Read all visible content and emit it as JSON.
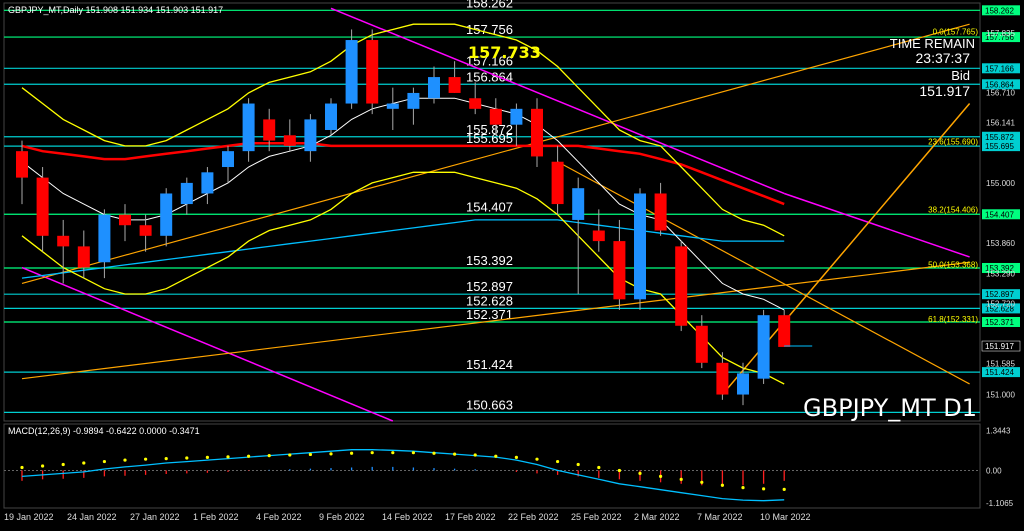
{
  "header": {
    "symbol_info": "GBPJPY_MT,Daily  151.908 151.934 151.903 151.917",
    "watermark": "GBPJPY_MT D1",
    "time_remain_label": "TIME REMAIN",
    "time_remain_value": "23:37:37",
    "bid_label": "Bid",
    "bid_value": "151.917",
    "highlight_price": "157.733"
  },
  "colors": {
    "background": "#000000",
    "bull": "#1e90ff",
    "bear": "#ff0000",
    "level_line": "#00ff7f",
    "level_line_cyan": "#00ced1",
    "magenta_channel": "#ff00ff",
    "yellow_band": "#ffff00",
    "orange_trend": "#ffa500",
    "red_ma": "#ff0000",
    "white_ma": "#ffffff",
    "cyan_ma": "#00bfff",
    "macd_line": "#00bfff",
    "macd_signal": "#ffff00"
  },
  "chart_data": {
    "type": "candlestick",
    "title": "GBPJPY_MT,Daily",
    "ylim": [
      150.5,
      158.4
    ],
    "candles": [
      {
        "d": "18 Jan 2022",
        "o": 155.6,
        "h": 155.8,
        "l": 154.6,
        "c": 155.1
      },
      {
        "d": "19 Jan 2022",
        "o": 155.1,
        "h": 155.3,
        "l": 153.7,
        "c": 154.0
      },
      {
        "d": "20 Jan 2022",
        "o": 154.0,
        "h": 154.3,
        "l": 153.1,
        "c": 153.8
      },
      {
        "d": "21 Jan 2022",
        "o": 153.8,
        "h": 154.1,
        "l": 153.2,
        "c": 153.4
      },
      {
        "d": "24 Jan 2022",
        "o": 153.5,
        "h": 154.5,
        "l": 153.2,
        "c": 154.4
      },
      {
        "d": "25 Jan 2022",
        "o": 154.4,
        "h": 154.6,
        "l": 153.9,
        "c": 154.2
      },
      {
        "d": "26 Jan 2022",
        "o": 154.2,
        "h": 154.4,
        "l": 153.7,
        "c": 154.0
      },
      {
        "d": "27 Jan 2022",
        "o": 154.0,
        "h": 154.9,
        "l": 153.8,
        "c": 154.8
      },
      {
        "d": "28 Jan 2022",
        "o": 154.6,
        "h": 155.1,
        "l": 154.4,
        "c": 155.0
      },
      {
        "d": "31 Jan 2022",
        "o": 154.8,
        "h": 155.3,
        "l": 154.6,
        "c": 155.2
      },
      {
        "d": "1 Feb 2022",
        "o": 155.3,
        "h": 155.7,
        "l": 155.0,
        "c": 155.6
      },
      {
        "d": "2 Feb 2022",
        "o": 155.6,
        "h": 156.6,
        "l": 155.4,
        "c": 156.5
      },
      {
        "d": "3 Feb 2022",
        "o": 156.2,
        "h": 156.4,
        "l": 155.6,
        "c": 155.8
      },
      {
        "d": "4 Feb 2022",
        "o": 155.9,
        "h": 156.2,
        "l": 155.6,
        "c": 155.7
      },
      {
        "d": "7 Feb 2022",
        "o": 155.6,
        "h": 156.3,
        "l": 155.4,
        "c": 156.2
      },
      {
        "d": "8 Feb 2022",
        "o": 156.0,
        "h": 156.6,
        "l": 155.9,
        "c": 156.5
      },
      {
        "d": "9 Feb 2022",
        "o": 156.5,
        "h": 157.9,
        "l": 156.4,
        "c": 157.7
      },
      {
        "d": "10 Feb 2022",
        "o": 157.7,
        "h": 157.9,
        "l": 156.3,
        "c": 156.5
      },
      {
        "d": "11 Feb 2022",
        "o": 156.4,
        "h": 156.8,
        "l": 156.0,
        "c": 156.5
      },
      {
        "d": "14 Feb 2022",
        "o": 156.4,
        "h": 156.8,
        "l": 156.1,
        "c": 156.7
      },
      {
        "d": "15 Feb 2022",
        "o": 156.6,
        "h": 157.2,
        "l": 156.5,
        "c": 157.0
      },
      {
        "d": "16 Feb 2022",
        "o": 157.0,
        "h": 157.3,
        "l": 156.7,
        "c": 156.7
      },
      {
        "d": "17 Feb 2022",
        "o": 156.6,
        "h": 156.9,
        "l": 156.3,
        "c": 156.4
      },
      {
        "d": "18 Feb 2022",
        "o": 156.4,
        "h": 156.6,
        "l": 155.9,
        "c": 156.1
      },
      {
        "d": "21 Feb 2022",
        "o": 156.1,
        "h": 156.5,
        "l": 155.7,
        "c": 156.4
      },
      {
        "d": "22 Feb 2022",
        "o": 156.4,
        "h": 156.6,
        "l": 155.3,
        "c": 155.5
      },
      {
        "d": "23 Feb 2022",
        "o": 155.4,
        "h": 155.7,
        "l": 154.4,
        "c": 154.6
      },
      {
        "d": "24 Feb 2022",
        "o": 154.3,
        "h": 155.1,
        "l": 152.9,
        "c": 154.9
      },
      {
        "d": "25 Feb 2022",
        "o": 154.1,
        "h": 154.5,
        "l": 153.7,
        "c": 153.9
      },
      {
        "d": "28 Feb 2022",
        "o": 153.9,
        "h": 154.3,
        "l": 152.6,
        "c": 152.8
      },
      {
        "d": "1 Mar 2022",
        "o": 152.8,
        "h": 154.9,
        "l": 152.6,
        "c": 154.8
      },
      {
        "d": "2 Mar 2022",
        "o": 154.8,
        "h": 155.0,
        "l": 154.0,
        "c": 154.1
      },
      {
        "d": "3 Mar 2022",
        "o": 153.8,
        "h": 153.9,
        "l": 152.2,
        "c": 152.3
      },
      {
        "d": "4 Mar 2022",
        "o": 152.3,
        "h": 152.5,
        "l": 151.5,
        "c": 151.6
      },
      {
        "d": "7 Mar 2022",
        "o": 151.6,
        "h": 151.8,
        "l": 150.9,
        "c": 151.0
      },
      {
        "d": "8 Mar 2022",
        "o": 151.0,
        "h": 151.6,
        "l": 150.8,
        "c": 151.4
      },
      {
        "d": "9 Mar 2022",
        "o": 151.3,
        "h": 152.6,
        "l": 151.2,
        "c": 152.5
      },
      {
        "d": "10 Mar 2022",
        "o": 152.5,
        "h": 152.6,
        "l": 151.9,
        "c": 151.9
      }
    ],
    "current_price": 151.917,
    "levels": [
      {
        "value": "158.262",
        "y": 158.262,
        "color": "#00ff7f",
        "price_label": "158.262",
        "show_label": true
      },
      {
        "value": "157.756",
        "y": 157.756,
        "color": "#00ff7f",
        "price_label": "157.756",
        "show_label": true
      },
      {
        "value": "157.166",
        "y": 157.166,
        "color": "#00ced1",
        "price_label": "157.166",
        "show_label": true
      },
      {
        "value": "156.864",
        "y": 156.864,
        "color": "#00ced1",
        "price_label": "156.864",
        "show_label": true
      },
      {
        "value": "155.872",
        "y": 155.872,
        "color": "#00ced1",
        "price_label": "155.872",
        "show_label": true
      },
      {
        "value": "155.695",
        "y": 155.695,
        "color": "#00ced1",
        "price_label": "155.695",
        "show_label": true
      },
      {
        "value": "154.407",
        "y": 154.407,
        "color": "#00ff7f",
        "price_label": "154.407",
        "show_label": true
      },
      {
        "value": "153.392",
        "y": 153.392,
        "color": "#00ff7f",
        "price_label": "153.392",
        "show_label": true
      },
      {
        "value": "152.897",
        "y": 152.897,
        "color": "#00ced1",
        "price_label": "152.897",
        "show_label": true
      },
      {
        "value": "152.628",
        "y": 152.628,
        "color": "#00ced1",
        "price_label": "152.628",
        "show_label": true
      },
      {
        "value": "152.371",
        "y": 152.371,
        "color": "#00ff7f",
        "price_label": "152.371",
        "show_label": true
      },
      {
        "value": "151.424",
        "y": 151.424,
        "color": "#00ced1",
        "price_label": "151.424",
        "show_label": true
      },
      {
        "value": "150.663",
        "y": 150.663,
        "color": "#00ced1",
        "price_label": "",
        "show_label": true
      }
    ],
    "fib_labels": [
      {
        "text": "0.0(157.765)",
        "y": 157.765
      },
      {
        "text": "23.6(155.690)",
        "y": 155.69
      },
      {
        "text": "38.2(154.406)",
        "y": 154.406
      },
      {
        "text": "50.0(153.368)",
        "y": 153.368
      },
      {
        "text": "61.8(152.331)",
        "y": 152.331
      }
    ],
    "price_axis_ticks": [
      "157.835",
      "156.710",
      "156.141",
      "155.000",
      "153.860",
      "153.290",
      "152.720",
      "151.585",
      "151.000"
    ],
    "x_tick_labels": [
      "19 Jan 2022",
      "24 Jan 2022",
      "27 Jan 2022",
      "1 Feb 2022",
      "4 Feb 2022",
      "9 Feb 2022",
      "14 Feb 2022",
      "17 Feb 2022",
      "22 Feb 2022",
      "25 Feb 2022",
      "2 Mar 2022",
      "7 Mar 2022",
      "10 Mar 2022"
    ],
    "moving_averages": {
      "red": [
        155.7,
        155.6,
        155.55,
        155.5,
        155.45,
        155.45,
        155.5,
        155.55,
        155.6,
        155.65,
        155.7,
        155.75,
        155.75,
        155.75,
        155.75,
        155.7,
        155.7,
        155.7,
        155.7,
        155.7,
        155.7,
        155.7,
        155.7,
        155.7,
        155.7,
        155.7,
        155.7,
        155.7,
        155.65,
        155.6,
        155.55,
        155.45,
        155.35,
        155.2,
        155.05,
        154.9,
        154.75,
        154.6
      ],
      "white": [
        155.4,
        155.1,
        154.8,
        154.6,
        154.4,
        154.3,
        154.3,
        154.4,
        154.6,
        154.8,
        155.0,
        155.3,
        155.5,
        155.6,
        155.7,
        155.9,
        156.2,
        156.4,
        156.5,
        156.6,
        156.6,
        156.6,
        156.5,
        156.4,
        156.3,
        156.1,
        155.8,
        155.4,
        155.0,
        154.6,
        154.4,
        154.3,
        153.9,
        153.5,
        153.1,
        152.9,
        152.8,
        152.6
      ],
      "cyan": [
        153.2,
        153.25,
        153.3,
        153.35,
        153.4,
        153.45,
        153.5,
        153.55,
        153.6,
        153.65,
        153.7,
        153.75,
        153.8,
        153.85,
        153.9,
        153.95,
        154.0,
        154.05,
        154.1,
        154.15,
        154.2,
        154.25,
        154.3,
        154.3,
        154.3,
        154.3,
        154.3,
        154.25,
        154.2,
        154.15,
        154.1,
        154.05,
        154.0,
        153.95,
        153.9,
        153.9,
        153.9,
        153.9
      ]
    },
    "macd": {
      "label": "MACD(12,26,9) -0.9894 -0.6422 0.0000 -0.3471",
      "ylim": [
        -1.2,
        1.5
      ],
      "ticks": [
        "1.3443",
        "0.00",
        "-1.1065"
      ],
      "hist": [
        -0.35,
        -0.3,
        -0.28,
        -0.25,
        -0.2,
        -0.18,
        -0.15,
        -0.12,
        -0.1,
        -0.08,
        -0.05,
        -0.02,
        0.02,
        0.04,
        0.06,
        0.08,
        0.1,
        0.12,
        0.12,
        0.1,
        0.08,
        0.06,
        0.04,
        0.0,
        -0.05,
        -0.1,
        -0.15,
        -0.2,
        -0.25,
        -0.3,
        -0.35,
        -0.4,
        -0.45,
        -0.5,
        -0.55,
        -0.5,
        -0.45,
        -0.35
      ],
      "line": [
        -0.2,
        -0.15,
        -0.1,
        -0.05,
        0.05,
        0.12,
        0.18,
        0.25,
        0.3,
        0.35,
        0.4,
        0.45,
        0.5,
        0.55,
        0.6,
        0.65,
        0.7,
        0.7,
        0.68,
        0.65,
        0.6,
        0.55,
        0.5,
        0.45,
        0.35,
        0.2,
        0.0,
        -0.15,
        -0.3,
        -0.45,
        -0.55,
        -0.65,
        -0.75,
        -0.85,
        -0.95,
        -1.0,
        -1.02,
        -0.99
      ],
      "signal": [
        0.1,
        0.15,
        0.2,
        0.25,
        0.3,
        0.35,
        0.38,
        0.4,
        0.42,
        0.44,
        0.46,
        0.48,
        0.5,
        0.52,
        0.54,
        0.56,
        0.58,
        0.6,
        0.6,
        0.6,
        0.58,
        0.55,
        0.52,
        0.48,
        0.44,
        0.38,
        0.3,
        0.2,
        0.1,
        0.0,
        -0.1,
        -0.2,
        -0.3,
        -0.4,
        -0.5,
        -0.58,
        -0.62,
        -0.64
      ]
    }
  }
}
